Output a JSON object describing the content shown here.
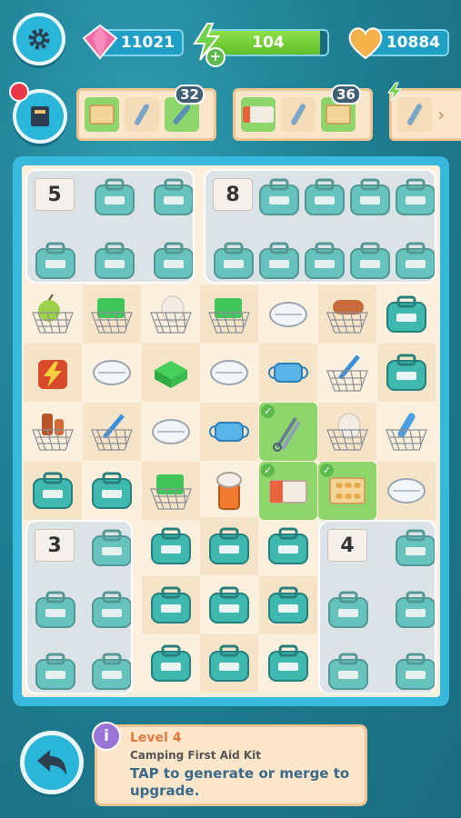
{
  "top_bar": {
    "gems": "11021",
    "energy": "104",
    "energy_fraction": 0.94,
    "coins": "10884"
  },
  "orders": [
    {
      "items": [
        "pill-pack-icon",
        "spatula-icon",
        "scalpel-icon"
      ],
      "badge": "32"
    },
    {
      "items": [
        "bandage-box-icon",
        "spatula-icon",
        "pill-pack-icon"
      ],
      "badge": "36"
    },
    {
      "items": [
        "spatula-icon"
      ],
      "badge": ""
    }
  ],
  "board": {
    "bags": [
      {
        "count": "5"
      },
      {
        "count": "8"
      },
      {
        "count": "3"
      },
      {
        "count": "4"
      }
    ],
    "rows": [
      [
        "net-apple",
        "net-green-box",
        "net-egg",
        "net-green-box",
        "white-pill",
        "net-sausage",
        "teal-kit"
      ],
      [
        "fire-bag",
        "white-pill",
        "green-box",
        "white-pill",
        "mask",
        "net-spatula",
        "teal-kit"
      ],
      [
        "net-bottle",
        "net-spatula",
        "white-pill",
        "mask",
        "forceps",
        "net-egg",
        "net-thermometer"
      ],
      [
        "teal-kit",
        "teal-kit",
        "net-green-box",
        "pill-bottle",
        "bandage-box",
        "pill-pack",
        "white-pill"
      ]
    ],
    "done_tiles": [
      "2-4",
      "3-4",
      "3-5"
    ]
  },
  "info": {
    "level": "Level 4",
    "item_name": "Camping First Aid Kit",
    "description": "TAP to generate or merge to upgrade."
  }
}
